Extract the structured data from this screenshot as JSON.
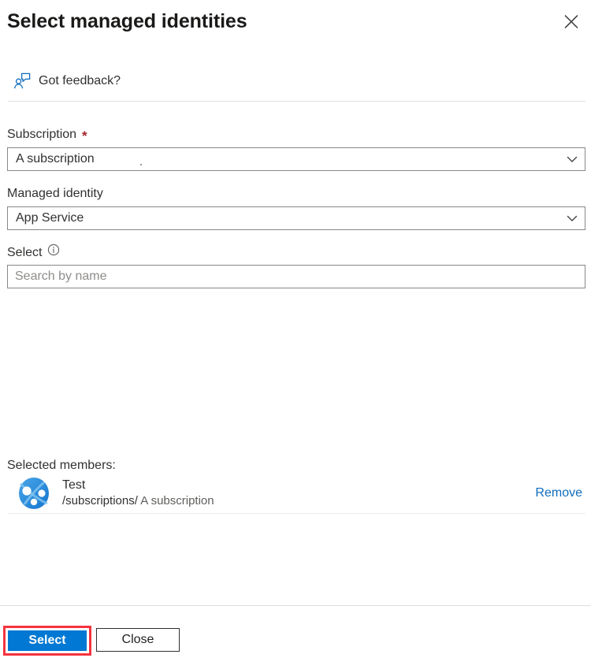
{
  "panel": {
    "title": "Select managed identities",
    "close_icon": "close-icon"
  },
  "feedback": {
    "label": "Got feedback?",
    "icon": "feedback-person-icon"
  },
  "fields": {
    "subscription": {
      "label": "Subscription",
      "required_marker": "*",
      "value": "A subscription",
      "chevron_icon": "chevron-down-icon"
    },
    "managed_identity": {
      "label": "Managed identity",
      "value": "App Service",
      "chevron_icon": "chevron-down-icon"
    },
    "select": {
      "label": "Select",
      "info_icon": "info-icon",
      "search_value": "",
      "search_placeholder": "Search by name"
    }
  },
  "selected_members": {
    "heading": "Selected members:",
    "items": [
      {
        "avatar_icon": "app-service-icon",
        "name": "Test",
        "path": "/subscriptions/",
        "subscription": "A subscription",
        "remove_label": "Remove"
      }
    ]
  },
  "footer": {
    "primary_label": "Select",
    "secondary_label": "Close"
  },
  "colors": {
    "accent": "#0078d4",
    "link": "#0f6cbd",
    "required": "#a4262c",
    "highlight": "#f5333f",
    "border": "#8a8886"
  }
}
